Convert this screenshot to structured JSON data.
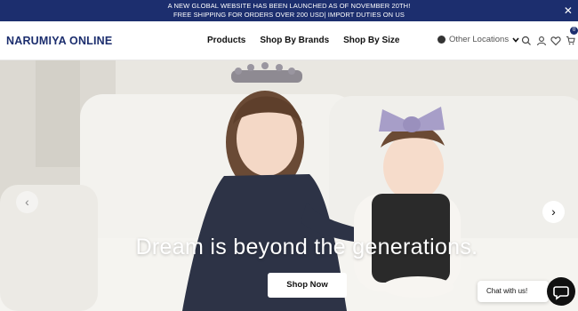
{
  "announcement": {
    "line1": "A NEW GLOBAL WEBSITE HAS BEEN LAUNCHED AS OF NOVEMBER 20TH!",
    "line2": "FREE SHIPPING FOR ORDERS OVER 200 USD| IMPORT DUTIES ON US",
    "close": "✕"
  },
  "header": {
    "logo": "NARUMIYA ONLINE",
    "nav": [
      "Products",
      "Shop By Brands",
      "Shop By Size"
    ],
    "location": "Other Locations",
    "cart_count": "0"
  },
  "hero": {
    "tagline": "Dream is beyond the generations.",
    "cta": "Shop Now",
    "prev": "‹",
    "next": "›"
  },
  "chat": {
    "label": "Chat with us!"
  },
  "icons": [
    "globe-icon",
    "chevron-down-icon",
    "search-icon",
    "user-icon",
    "heart-icon",
    "cart-icon",
    "close-icon",
    "chat-icon"
  ],
  "colors": {
    "brand": "#1c2e6e",
    "announcement_bg": "#1c2e6e"
  }
}
